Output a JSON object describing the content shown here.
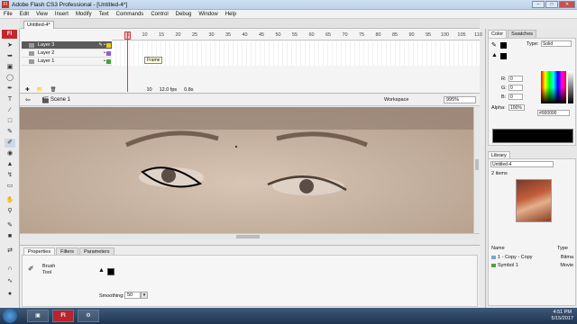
{
  "window": {
    "app_icon": "Fl",
    "title": "Adobe Flash CS3 Professional - [Untitled-4*]"
  },
  "menu": [
    "File",
    "Edit",
    "View",
    "Insert",
    "Modify",
    "Text",
    "Commands",
    "Control",
    "Debug",
    "Window",
    "Help"
  ],
  "toolbox": {
    "badge": "Fl"
  },
  "document_tab": "Untitled-4*",
  "timeline": {
    "frame_numbers": [
      "5",
      "10",
      "15",
      "20",
      "25",
      "30",
      "35",
      "40",
      "45",
      "50",
      "55",
      "60",
      "65",
      "70",
      "75",
      "80",
      "85",
      "90",
      "95",
      "100",
      "105",
      "110"
    ],
    "layers": [
      {
        "name": "Layer 3",
        "selected": true,
        "color": "#f0d000"
      },
      {
        "name": "Layer 2",
        "selected": false,
        "color": "#9b59d0"
      },
      {
        "name": "Layer 1",
        "selected": false,
        "color": "#3aa63a"
      }
    ],
    "tooltip": "Frame",
    "current_frame": "10",
    "fps": "12.0 fps",
    "time": "0.8s"
  },
  "stagebar": {
    "scene": "Scene 1",
    "workspace": "Workspace",
    "zoom": "995%"
  },
  "properties": {
    "tabs": [
      "Properties",
      "Filters",
      "Parameters"
    ],
    "tool_name": "Brush",
    "tool_sub": "Tool",
    "smoothing_label": "Smoothing:",
    "smoothing_value": "50"
  },
  "color_panel": {
    "tabs": [
      "Color",
      "Swatches"
    ],
    "type_label": "Type:",
    "type_value": "Solid",
    "r_label": "R:",
    "g_label": "G:",
    "b_label": "B:",
    "r_value": "0",
    "g_value": "0",
    "b_value": "0",
    "alpha_label": "Alpha:",
    "alpha_value": "100%",
    "hex_value": "#000000"
  },
  "library": {
    "tab": "Library",
    "doc": "Untitled-4",
    "item_count": "2 items",
    "columns": [
      "Name",
      "Type"
    ],
    "items": [
      {
        "name": "1 - Copy - Copy",
        "type": "Bitma"
      },
      {
        "name": "Symbol 1",
        "type": "Movie"
      }
    ]
  },
  "taskbar": {
    "buttons": [
      "Fl"
    ],
    "time": "4:51 PM",
    "date": "5/15/2017"
  },
  "colors": {
    "playhead": "#e03b3b",
    "flash_brand": "#c4262e"
  }
}
